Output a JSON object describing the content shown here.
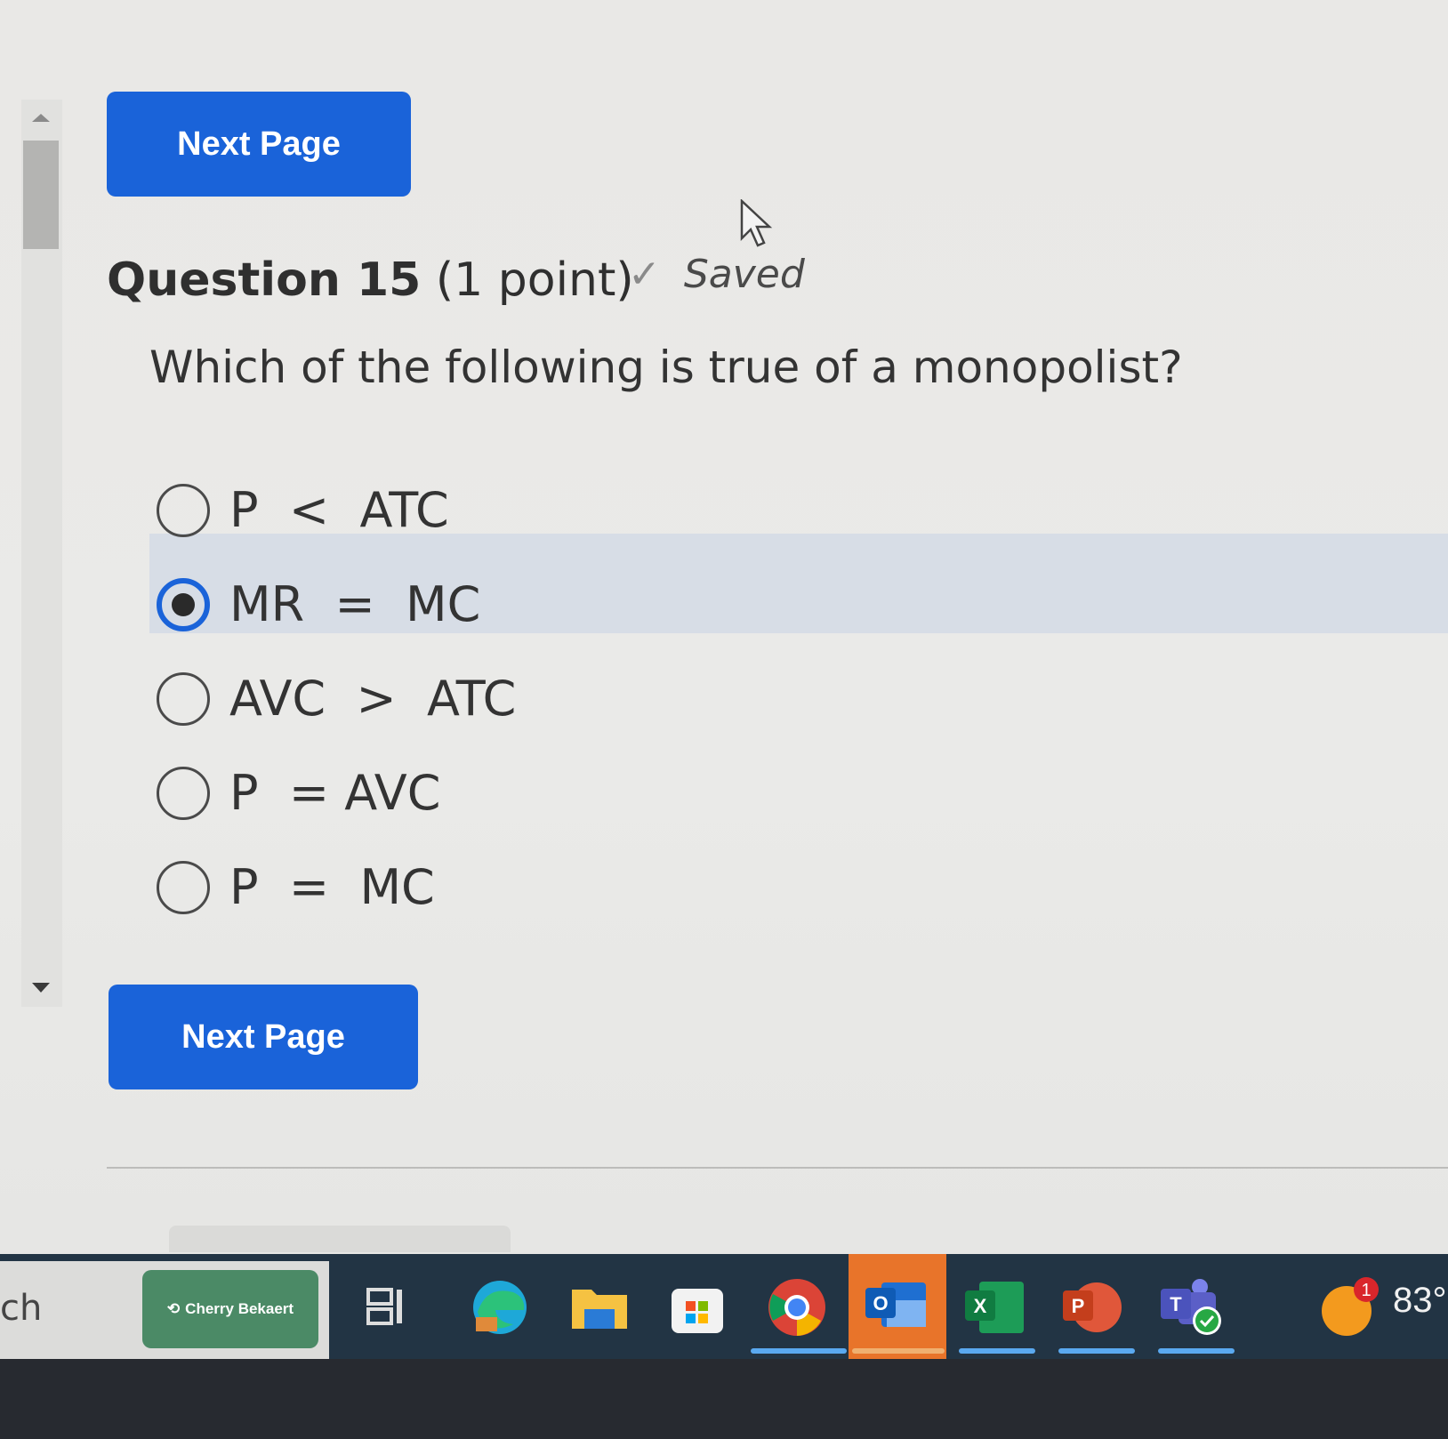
{
  "buttons": {
    "next_page_top": "Next Page",
    "next_page_bottom": "Next Page"
  },
  "question": {
    "title_bold": "Question 15",
    "title_points": " (1 point)",
    "saved_label": "Saved",
    "prompt": "Which of the following is true of a monopolist?",
    "options": [
      {
        "label": "P  <  ATC",
        "selected": false
      },
      {
        "label": "MR  =  MC",
        "selected": true
      },
      {
        "label": "AVC  >  ATC",
        "selected": false
      },
      {
        "label": "P  = AVC",
        "selected": false
      },
      {
        "label": "P  =  MC",
        "selected": false
      }
    ]
  },
  "taskbar": {
    "search_text": "ch",
    "cherry_label": "Cherry Bekaert",
    "weather_badge": "1",
    "weather_temp": "83°",
    "icons": [
      "task-view-icon",
      "edge-icon",
      "file-explorer-icon",
      "store-icon",
      "chrome-icon",
      "outlook-icon",
      "excel-icon",
      "powerpoint-icon",
      "teams-icon"
    ]
  },
  "colors": {
    "primary_blue": "#1a63d9",
    "selected_row": "#d7dde6",
    "taskbar": "#223444"
  }
}
